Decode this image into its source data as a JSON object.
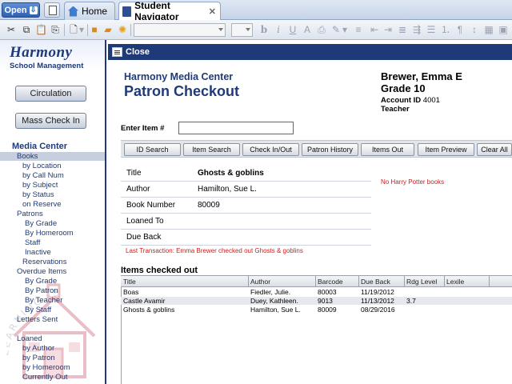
{
  "tabs": {
    "open_label": "Open",
    "home_label": "Home",
    "navigator_label": "Student Navigator",
    "close_glyph": "✕"
  },
  "toolbar": {
    "font_value": "",
    "size_value": "",
    "icons": [
      "cut-icon",
      "copy-icon",
      "paste-icon",
      "paste-format-icon",
      "new-doc-icon",
      "save-icon",
      "folder-icon",
      "settings-icon",
      "bold-icon",
      "italic-icon",
      "underline-icon",
      "font-color-icon",
      "highlight-icon",
      "pen-icon",
      "align-left-icon",
      "align-center-icon",
      "align-right-icon",
      "justify-icon",
      "indent-icon",
      "bullets-icon",
      "numbering-icon",
      "table-icon",
      "image-icon"
    ]
  },
  "sidebar": {
    "logo_title": "Harmony",
    "logo_subtitle": "School Management",
    "circulation_label": "Circulation",
    "mass_checkin_label": "Mass Check In",
    "section_label": "Media Center",
    "items": [
      {
        "label": "Books",
        "selected": true
      },
      {
        "label": "by Location"
      },
      {
        "label": "by Call Num"
      },
      {
        "label": "by Subject"
      },
      {
        "label": "by Status"
      },
      {
        "label": "on Reserve"
      },
      {
        "label": "Patrons"
      },
      {
        "label": "By Grade"
      },
      {
        "label": "By Homeroom"
      },
      {
        "label": "Staff"
      },
      {
        "label": "Inactive"
      },
      {
        "label": "Reservations"
      },
      {
        "label": "Overdue Items"
      },
      {
        "label": "By Grade"
      },
      {
        "label": "By Patron"
      },
      {
        "label": "By Teacher"
      },
      {
        "label": "By Staff"
      },
      {
        "label": "Letters Sent"
      },
      {
        "label": "Loaned"
      },
      {
        "label": "by Author"
      },
      {
        "label": "by Patron"
      },
      {
        "label": "by Homeroom"
      },
      {
        "label": "Currently Out"
      }
    ]
  },
  "main": {
    "close_label": "Close",
    "center_name": "Harmony Media Center",
    "page_title": "Patron Checkout",
    "enter_item_label": "Enter Item #",
    "enter_item_value": ""
  },
  "patron": {
    "name": "Brewer, Emma E",
    "grade": "Grade 10",
    "account_label": "Account ID",
    "account_id": "4001",
    "teacher_label": "Teacher"
  },
  "actions": [
    "ID Search",
    "Item Search",
    "Check In/Out",
    "Patron History",
    "Items Out",
    "Item Preview",
    "Clear All"
  ],
  "item_detail": {
    "rows": [
      {
        "label": "Title",
        "value": "Ghosts & goblins",
        "bold": true
      },
      {
        "label": "Author",
        "value": "Hamilton, Sue L."
      },
      {
        "label": "Book Number",
        "value": "80009"
      },
      {
        "label": "Loaned To",
        "value": ""
      },
      {
        "label": "Due Back",
        "value": ""
      }
    ],
    "last_transaction": "Last Transaction: Emma Brewer checked out Ghosts & goblins",
    "notice": "No Harry Potter books"
  },
  "checked_out": {
    "title": "Items checked out",
    "columns": [
      "Title",
      "Author",
      "Barcode",
      "Due Back",
      "Rdg Level",
      "Lexile"
    ],
    "rows": [
      [
        "Boas",
        "Fiedler, Julie.",
        "80003",
        "11/19/2012",
        "",
        ""
      ],
      [
        "Castle Avamir",
        "Duey, Kathleen.",
        "9013",
        "11/13/2012",
        "3.7",
        ""
      ],
      [
        "Ghosts & goblins",
        "Hamilton, Sue L.",
        "80009",
        "08/29/2016",
        "",
        ""
      ]
    ]
  },
  "watermark_text": "LEARNING IS"
}
